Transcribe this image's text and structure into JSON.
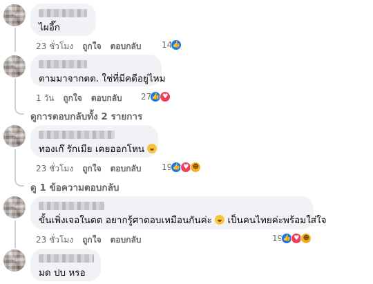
{
  "labels": {
    "like": "ถูกใจ",
    "reply": "ตอบกลับ"
  },
  "comments": [
    {
      "text": "ไผอี๊ก",
      "time": "23 ชั่วโมง",
      "reaction_count": "14",
      "reactions": [
        "like"
      ]
    },
    {
      "text": "ตามมาจากตต. ใช่ที่มีคดีอยู่ไหม",
      "time": "1 วัน",
      "reaction_count": "27",
      "reactions": [
        "like",
        "love"
      ]
    },
    {
      "text": "ทองเก๊ รักเมีย เคยออกโหน",
      "emoji": "face-emoji",
      "time": "23 ชั่วโมง",
      "reaction_count": "19",
      "reactions": [
        "like",
        "love",
        "care"
      ]
    },
    {
      "text_part1": "ขั้นเพิ่งเจอในตต อยากรู้ศาตอบเหมือนกันค่ะ",
      "text_part2": "เป็นคนไทยค่ะพร้อมใส่ใจ",
      "emoji": "face-emoji",
      "time": "23 ชั่วโมง",
      "reaction_count": "19",
      "reactions": [
        "like",
        "love",
        "care"
      ]
    },
    {
      "text": "มด ปบ หรอ"
    }
  ],
  "reply_links": [
    {
      "label": "ดูการตอบกลับทั้ง 2 รายการ"
    },
    {
      "label": "ดู 1 ข้อความตอบกลับ"
    }
  ],
  "colors": {
    "bubble": "#f0f2f5",
    "meta_text": "#65676b",
    "like": "#1877f2",
    "love": "#f33e58",
    "care": "#f7b125"
  }
}
